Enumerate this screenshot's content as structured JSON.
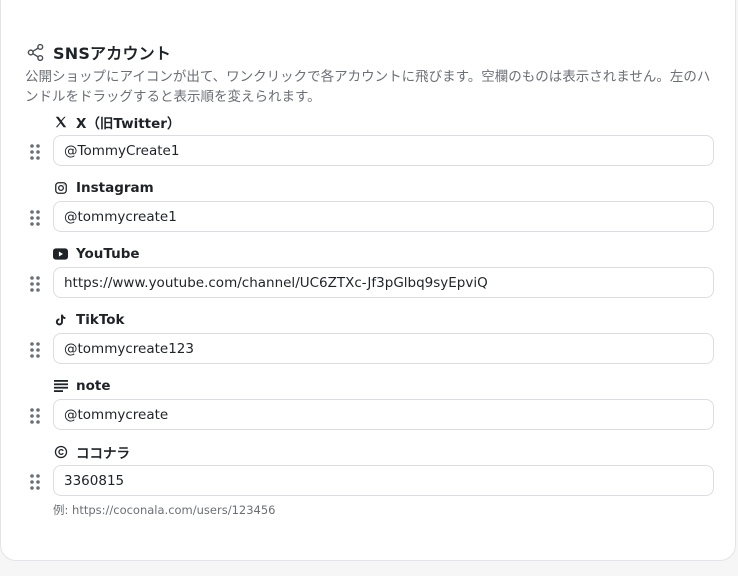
{
  "section": {
    "title": "SNSアカウント",
    "description": "公開ショップにアイコンが出て、ワンクリックで各アカウントに飛びます。空欄のものは表示されません。左のハンドルをドラッグすると表示順を変えられます。"
  },
  "accounts": [
    {
      "label": "X（旧Twitter）",
      "value": "@TommyCreate1",
      "icon": "x-icon"
    },
    {
      "label": "Instagram",
      "value": "@tommycreate1",
      "icon": "instagram-icon"
    },
    {
      "label": "YouTube",
      "value": "https://www.youtube.com/channel/UC6ZTXc-Jf3pGlbq9syEpviQ",
      "icon": "youtube-icon"
    },
    {
      "label": "TikTok",
      "value": "@tommycreate123",
      "icon": "tiktok-icon"
    },
    {
      "label": "note",
      "value": "@tommycreate",
      "icon": "note-icon"
    },
    {
      "label": "ココナラ",
      "value": "3360815",
      "icon": "coconala-icon"
    }
  ],
  "hint": "例: https://coconala.com/users/123456",
  "colors": {
    "text": "#1f2328",
    "muted": "#6b6f76",
    "border": "#dcdde1",
    "background": "#f6f6f7"
  }
}
